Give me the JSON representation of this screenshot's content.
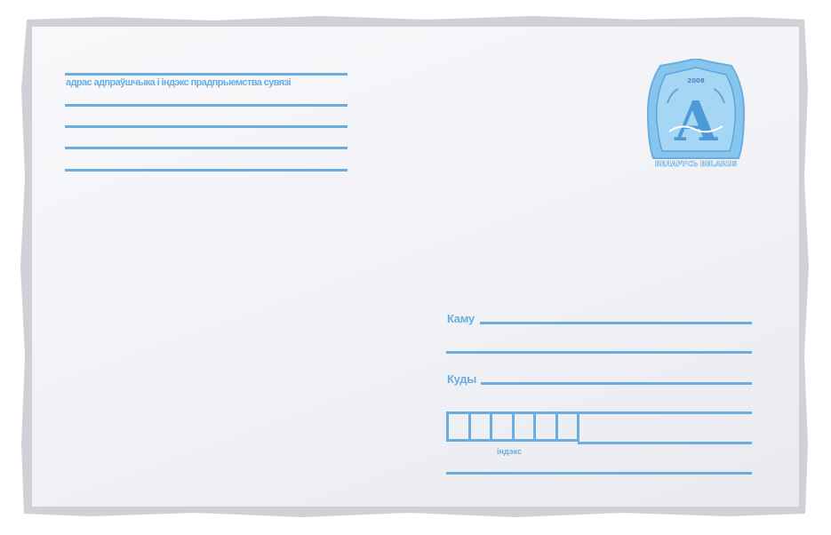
{
  "sender": {
    "caption": "адрас адпраўшчыка і індэкс прадпрыемства сувязі"
  },
  "recipient": {
    "to_label": "Каму",
    "where_label": "Куды",
    "index_caption": "індэкс",
    "index_cells": 6
  },
  "stamp": {
    "year": "2008",
    "country": "БЕЛАРУСЬ BELARUS",
    "emblem": "letter-a-emblem"
  },
  "colors": {
    "line": "#6aaee0",
    "stamp": "#7dbfea",
    "frame": "#d0d1d6",
    "paper": "#f3f4f8"
  }
}
